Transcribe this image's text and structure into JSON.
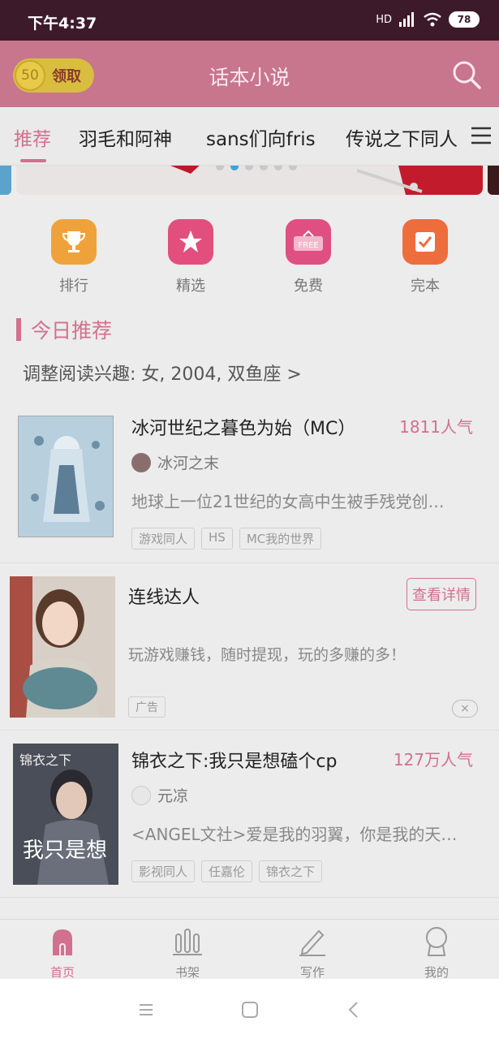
{
  "status_bar": {
    "time": "下午4:37",
    "network": "HD",
    "battery": "78"
  },
  "header": {
    "coin_count": "50",
    "coin_label": "领取",
    "title": "话本小说"
  },
  "tabs": [
    "推荐",
    "羽毛和阿神",
    "sans们向fris",
    "传说之下同人"
  ],
  "quick_links": [
    "排行",
    "精选",
    "免费",
    "完本"
  ],
  "section": {
    "title": "今日推荐",
    "interest": "调整阅读兴趣: 女, 2004, 双鱼座 >"
  },
  "books": [
    {
      "title": "冰河世纪之暮色为始（MC）",
      "popularity": "1811人气",
      "author": "冰河之末",
      "description": "地球上一位21世纪的女高中生被手残党创…",
      "tags": [
        "游戏同人",
        "HS",
        "MC我的世界"
      ]
    },
    {
      "title": "锦衣之下:我只是想磕个cp",
      "popularity": "127万人气",
      "author": "元凉",
      "description": "<ANGEL文社>爱是我的羽翼，你是我的天…",
      "tags": [
        "影视同人",
        "任嘉伦",
        "锦衣之下"
      ]
    }
  ],
  "ad": {
    "title": "连线达人",
    "detail_button": "查看详情",
    "description": "玩游戏赚钱，随时提现，玩的多赚的多！",
    "label": "广告",
    "close": "×"
  },
  "bottom_nav": [
    "首页",
    "书架",
    "写作",
    "我的"
  ],
  "colors": {
    "accent": "#d2708f",
    "header": "#c8758e",
    "status": "#3d1a2a"
  }
}
